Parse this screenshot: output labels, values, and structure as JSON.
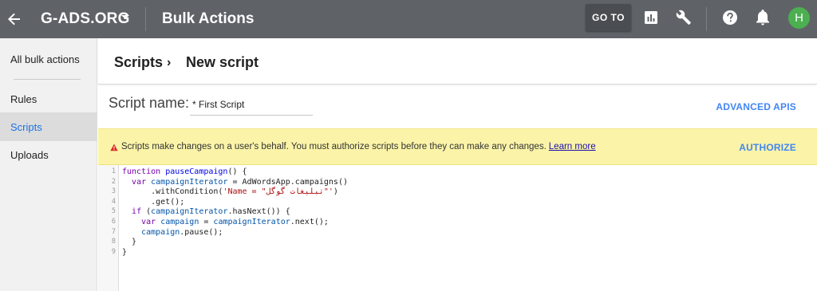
{
  "topbar": {
    "back_icon": "arrow-back-icon",
    "account_name": "G-ADS.ORG",
    "section_title": "Bulk Actions",
    "goto_label": "GO TO",
    "icons": [
      "reports-icon",
      "tools-wrench-icon",
      "help-icon",
      "notifications-bell-icon"
    ],
    "avatar_letter": "H",
    "avatar_color": "#4caf50",
    "bar_color": "#5f6368"
  },
  "sidebar": {
    "items": [
      {
        "label": "All bulk actions",
        "active": false
      },
      {
        "label": "Rules",
        "active": false
      },
      {
        "label": "Scripts",
        "active": true
      },
      {
        "label": "Uploads",
        "active": false
      }
    ]
  },
  "breadcrumb": {
    "parent": "Scripts",
    "separator": "›",
    "current": "New script"
  },
  "script_name": {
    "label": "Script name:",
    "value": "* First Script",
    "advanced_apis_label": "ADVANCED APIS"
  },
  "warning": {
    "message": "Scripts make changes on a user's behalf. You must authorize scripts before they can make any changes.",
    "learn_more": "Learn more",
    "authorize_label": "AUTHORIZE",
    "background": "#fbf4a8"
  },
  "editor": {
    "line_numbers": [
      "1",
      "2",
      "3",
      "4",
      "5",
      "6",
      "7",
      "8",
      "9"
    ],
    "lines": [
      [
        {
          "t": "kw",
          "s": "function "
        },
        {
          "t": "fn",
          "s": "pauseCampaign"
        },
        {
          "t": "pl",
          "s": "() {"
        }
      ],
      [
        {
          "t": "pl",
          "s": "  "
        },
        {
          "t": "kw",
          "s": "var "
        },
        {
          "t": "vr",
          "s": "campaignIterator"
        },
        {
          "t": "pl",
          "s": " = AdWordsApp.campaigns()"
        }
      ],
      [
        {
          "t": "pl",
          "s": "      .withCondition("
        },
        {
          "t": "st",
          "s": "'Name = \"تبلیغات گوگل\"'"
        },
        {
          "t": "pl",
          "s": ")"
        }
      ],
      [
        {
          "t": "pl",
          "s": "      .get();"
        }
      ],
      [
        {
          "t": "pl",
          "s": "  "
        },
        {
          "t": "kw",
          "s": "if "
        },
        {
          "t": "pl",
          "s": "("
        },
        {
          "t": "vr",
          "s": "campaignIterator"
        },
        {
          "t": "pl",
          "s": ".hasNext()) {"
        }
      ],
      [
        {
          "t": "pl",
          "s": "    "
        },
        {
          "t": "kw",
          "s": "var "
        },
        {
          "t": "vr",
          "s": "campaign"
        },
        {
          "t": "pl",
          "s": " = "
        },
        {
          "t": "vr",
          "s": "campaignIterator"
        },
        {
          "t": "pl",
          "s": ".next();"
        }
      ],
      [
        {
          "t": "pl",
          "s": "    "
        },
        {
          "t": "vr",
          "s": "campaign"
        },
        {
          "t": "pl",
          "s": ".pause();"
        }
      ],
      [
        {
          "t": "pl",
          "s": "  }"
        }
      ],
      [
        {
          "t": "pl",
          "s": "}"
        }
      ]
    ]
  }
}
